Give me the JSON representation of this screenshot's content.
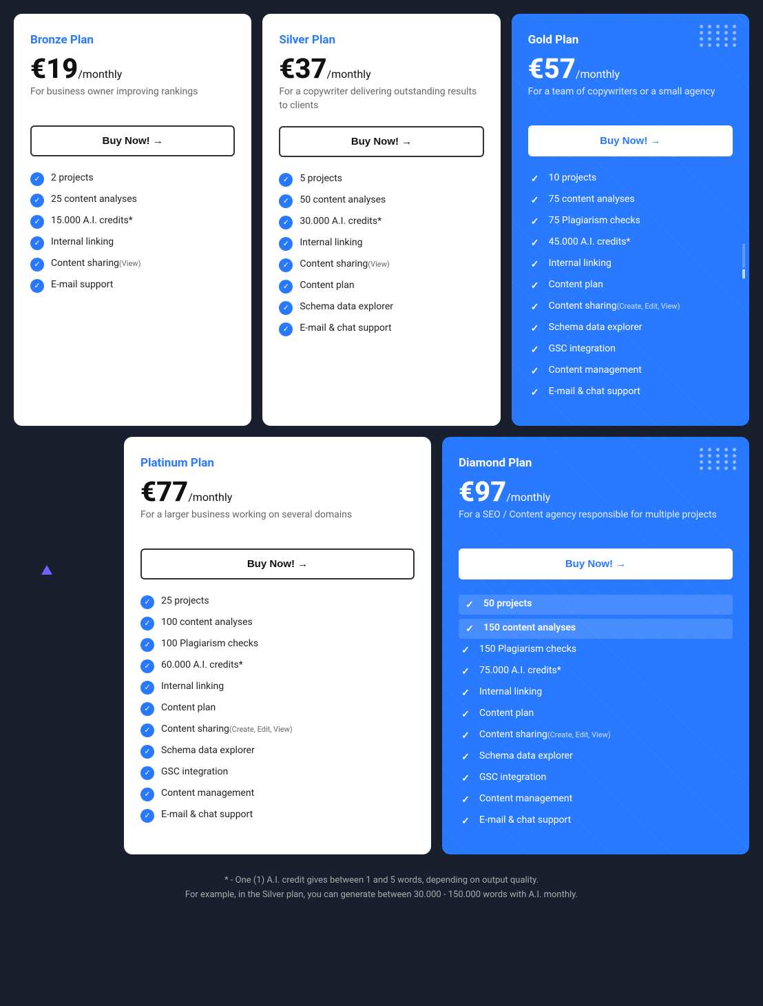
{
  "plans": {
    "bronze": {
      "name": "Bronze Plan",
      "price": "€19",
      "period": "/monthly",
      "description": "For business owner improving rankings",
      "buyLabel": "Buy Now!  →",
      "features": [
        {
          "text": "2 projects",
          "small": ""
        },
        {
          "text": "25 content analyses",
          "small": ""
        },
        {
          "text": "15.000 A.I. credits*",
          "small": ""
        },
        {
          "text": "Internal linking",
          "small": ""
        },
        {
          "text": "Content sharing",
          "small": "(View)"
        },
        {
          "text": "E-mail support",
          "small": ""
        }
      ]
    },
    "silver": {
      "name": "Silver Plan",
      "price": "€37",
      "period": "/monthly",
      "description": "For a copywriter delivering outstanding results to clients",
      "buyLabel": "Buy Now!  →",
      "features": [
        {
          "text": "5 projects",
          "small": ""
        },
        {
          "text": "50 content analyses",
          "small": ""
        },
        {
          "text": "30.000 A.I. credits*",
          "small": ""
        },
        {
          "text": "Internal linking",
          "small": ""
        },
        {
          "text": "Content sharing",
          "small": "(View)"
        },
        {
          "text": "Content plan",
          "small": ""
        },
        {
          "text": "Schema data explorer",
          "small": ""
        },
        {
          "text": "E-mail & chat support",
          "small": ""
        }
      ]
    },
    "gold": {
      "name": "Gold Plan",
      "price": "€57",
      "period": "/monthly",
      "description": "For a team of copywriters or a small agency",
      "buyLabel": "Buy Now!  →",
      "features": [
        {
          "text": "10 projects",
          "small": ""
        },
        {
          "text": "75 content analyses",
          "small": ""
        },
        {
          "text": "75 Plagiarism checks",
          "small": ""
        },
        {
          "text": "45.000 A.I. credits*",
          "small": ""
        },
        {
          "text": "Internal linking",
          "small": ""
        },
        {
          "text": "Content plan",
          "small": ""
        },
        {
          "text": "Content sharing",
          "small": "(Create, Edit, View)"
        },
        {
          "text": "Schema data explorer",
          "small": ""
        },
        {
          "text": "GSC integration",
          "small": ""
        },
        {
          "text": "Content management",
          "small": ""
        },
        {
          "text": "E-mail & chat support",
          "small": ""
        }
      ]
    },
    "platinum": {
      "name": "Platinum Plan",
      "price": "€77",
      "period": "/monthly",
      "description": "For a larger business working on several domains",
      "buyLabel": "Buy Now!  →",
      "features": [
        {
          "text": "25 projects",
          "small": ""
        },
        {
          "text": "100 content analyses",
          "small": ""
        },
        {
          "text": "100 Plagiarism checks",
          "small": ""
        },
        {
          "text": "60.000 A.I. credits*",
          "small": ""
        },
        {
          "text": "Internal linking",
          "small": ""
        },
        {
          "text": "Content plan",
          "small": ""
        },
        {
          "text": "Content sharing",
          "small": "(Create, Edit, View)"
        },
        {
          "text": "Schema data explorer",
          "small": ""
        },
        {
          "text": "GSC integration",
          "small": ""
        },
        {
          "text": "Content management",
          "small": ""
        },
        {
          "text": "E-mail & chat support",
          "small": ""
        }
      ]
    },
    "diamond": {
      "name": "Diamond Plan",
      "price": "€97",
      "period": "/monthly",
      "description": "For a SEO / Content agency responsible for multiple projects",
      "buyLabel": "Buy Now!  →",
      "features": [
        {
          "text": "50 projects",
          "small": ""
        },
        {
          "text": "150 content analyses",
          "small": ""
        },
        {
          "text": "150 Plagiarism checks",
          "small": ""
        },
        {
          "text": "75.000 A.I. credits*",
          "small": ""
        },
        {
          "text": "Internal linking",
          "small": ""
        },
        {
          "text": "Content plan",
          "small": ""
        },
        {
          "text": "Content sharing",
          "small": "(Create, Edit, View)"
        },
        {
          "text": "Schema data explorer",
          "small": ""
        },
        {
          "text": "GSC integration",
          "small": ""
        },
        {
          "text": "Content management",
          "small": ""
        },
        {
          "text": "E-mail & chat support",
          "small": ""
        }
      ]
    }
  },
  "footnote": {
    "line1": "* - One (1) A.I. credit gives between 1 and 5 words, depending on output quality.",
    "line2": "For example, in the Silver plan, you can generate between 30.000 - 150.000 words with A.I. monthly."
  }
}
